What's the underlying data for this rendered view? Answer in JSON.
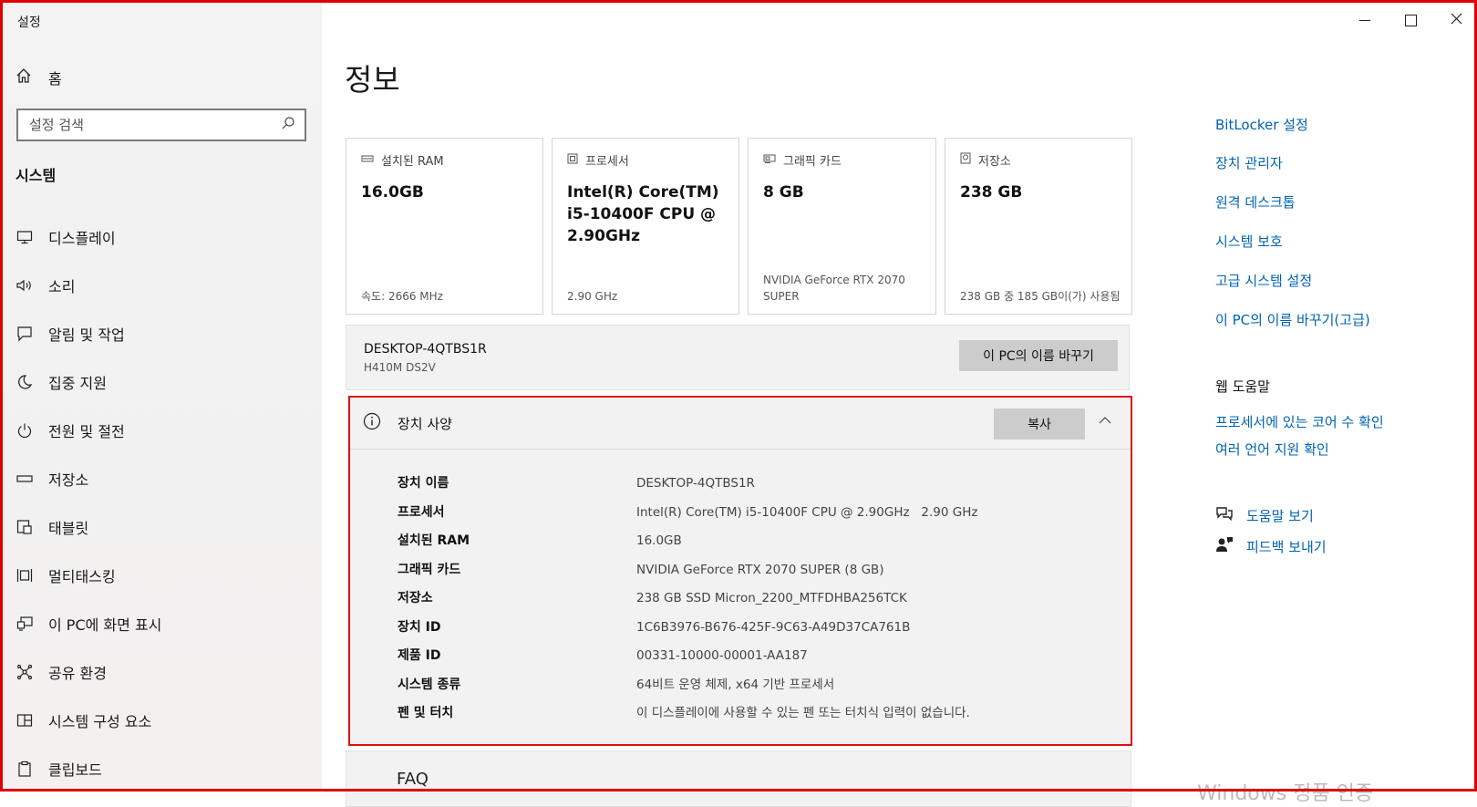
{
  "window": {
    "title": "설정"
  },
  "sidebar": {
    "home_label": "홈",
    "search_placeholder": "설정 검색",
    "section": "시스템",
    "items": [
      {
        "label": "디스플레이",
        "icon": "monitor-icon"
      },
      {
        "label": "소리",
        "icon": "speaker-icon"
      },
      {
        "label": "알림 및 작업",
        "icon": "notification-icon"
      },
      {
        "label": "집중 지원",
        "icon": "moon-icon"
      },
      {
        "label": "전원 및 절전",
        "icon": "power-icon"
      },
      {
        "label": "저장소",
        "icon": "storage-icon"
      },
      {
        "label": "태블릿",
        "icon": "tablet-icon"
      },
      {
        "label": "멀티태스킹",
        "icon": "multitask-icon"
      },
      {
        "label": "이 PC에 화면 표시",
        "icon": "project-icon"
      },
      {
        "label": "공유 환경",
        "icon": "share-icon"
      },
      {
        "label": "시스템 구성 요소",
        "icon": "components-icon"
      },
      {
        "label": "클립보드",
        "icon": "clipboard-icon"
      }
    ]
  },
  "main": {
    "title": "정보",
    "cards": [
      {
        "label": "설치된 RAM",
        "value": "16.0GB",
        "sub": "속도: 2666 MHz",
        "icon": "ram-icon"
      },
      {
        "label": "프로세서",
        "value": "Intel(R) Core(TM) i5-10400F CPU @ 2.90GHz",
        "sub": "2.90 GHz",
        "icon": "cpu-icon"
      },
      {
        "label": "그래픽 카드",
        "value": "8 GB",
        "sub": "NVIDIA GeForce RTX 2070 SUPER",
        "icon": "gpu-icon"
      },
      {
        "label": "저장소",
        "value": "238 GB",
        "sub": "238 GB 중 185 GB이(가) 사용됨",
        "icon": "disk-icon"
      }
    ],
    "pc": {
      "name": "DESKTOP-4QTBS1R",
      "model": "H410M DS2V",
      "rename_label": "이 PC의 이름 바꾸기"
    },
    "specs": {
      "title": "장치 사양",
      "copy_label": "복사",
      "rows": [
        {
          "key": "장치 이름",
          "value": "DESKTOP-4QTBS1R"
        },
        {
          "key": "프로세서",
          "value": "Intel(R) Core(TM) i5-10400F CPU @ 2.90GHz   2.90 GHz"
        },
        {
          "key": "설치된 RAM",
          "value": "16.0GB"
        },
        {
          "key": "그래픽 카드",
          "value": "NVIDIA GeForce RTX 2070 SUPER (8 GB)"
        },
        {
          "key": "저장소",
          "value": "238 GB SSD Micron_2200_MTFDHBA256TCK"
        },
        {
          "key": "장치 ID",
          "value": "1C6B3976-B676-425F-9C63-A49D37CA761B"
        },
        {
          "key": "제품 ID",
          "value": "00331-10000-00001-AA187"
        },
        {
          "key": "시스템 종류",
          "value": "64비트 운영 체제, x64 기반 프로세서"
        },
        {
          "key": "펜 및 터치",
          "value": "이 디스플레이에 사용할 수 있는 펜 또는 터치식 입력이 없습니다."
        }
      ]
    },
    "faq_label": "FAQ"
  },
  "right": {
    "links": [
      "BitLocker 설정",
      "장치 관리자",
      "원격 데스크톱",
      "시스템 보호",
      "고급 시스템 설정",
      "이 PC의 이름 바꾸기(고급)"
    ],
    "web_help_title": "웹 도움말",
    "web_links": [
      "프로세서에 있는 코어 수 확인",
      "여러 언어 지원 확인"
    ],
    "help_label": "도움말 보기",
    "feedback_label": "피드백 보내기"
  },
  "watermark": "Windows 정품 인증",
  "colors": {
    "link": "#0063b1",
    "highlight_border": "#e01010",
    "button": "#cccccc"
  }
}
